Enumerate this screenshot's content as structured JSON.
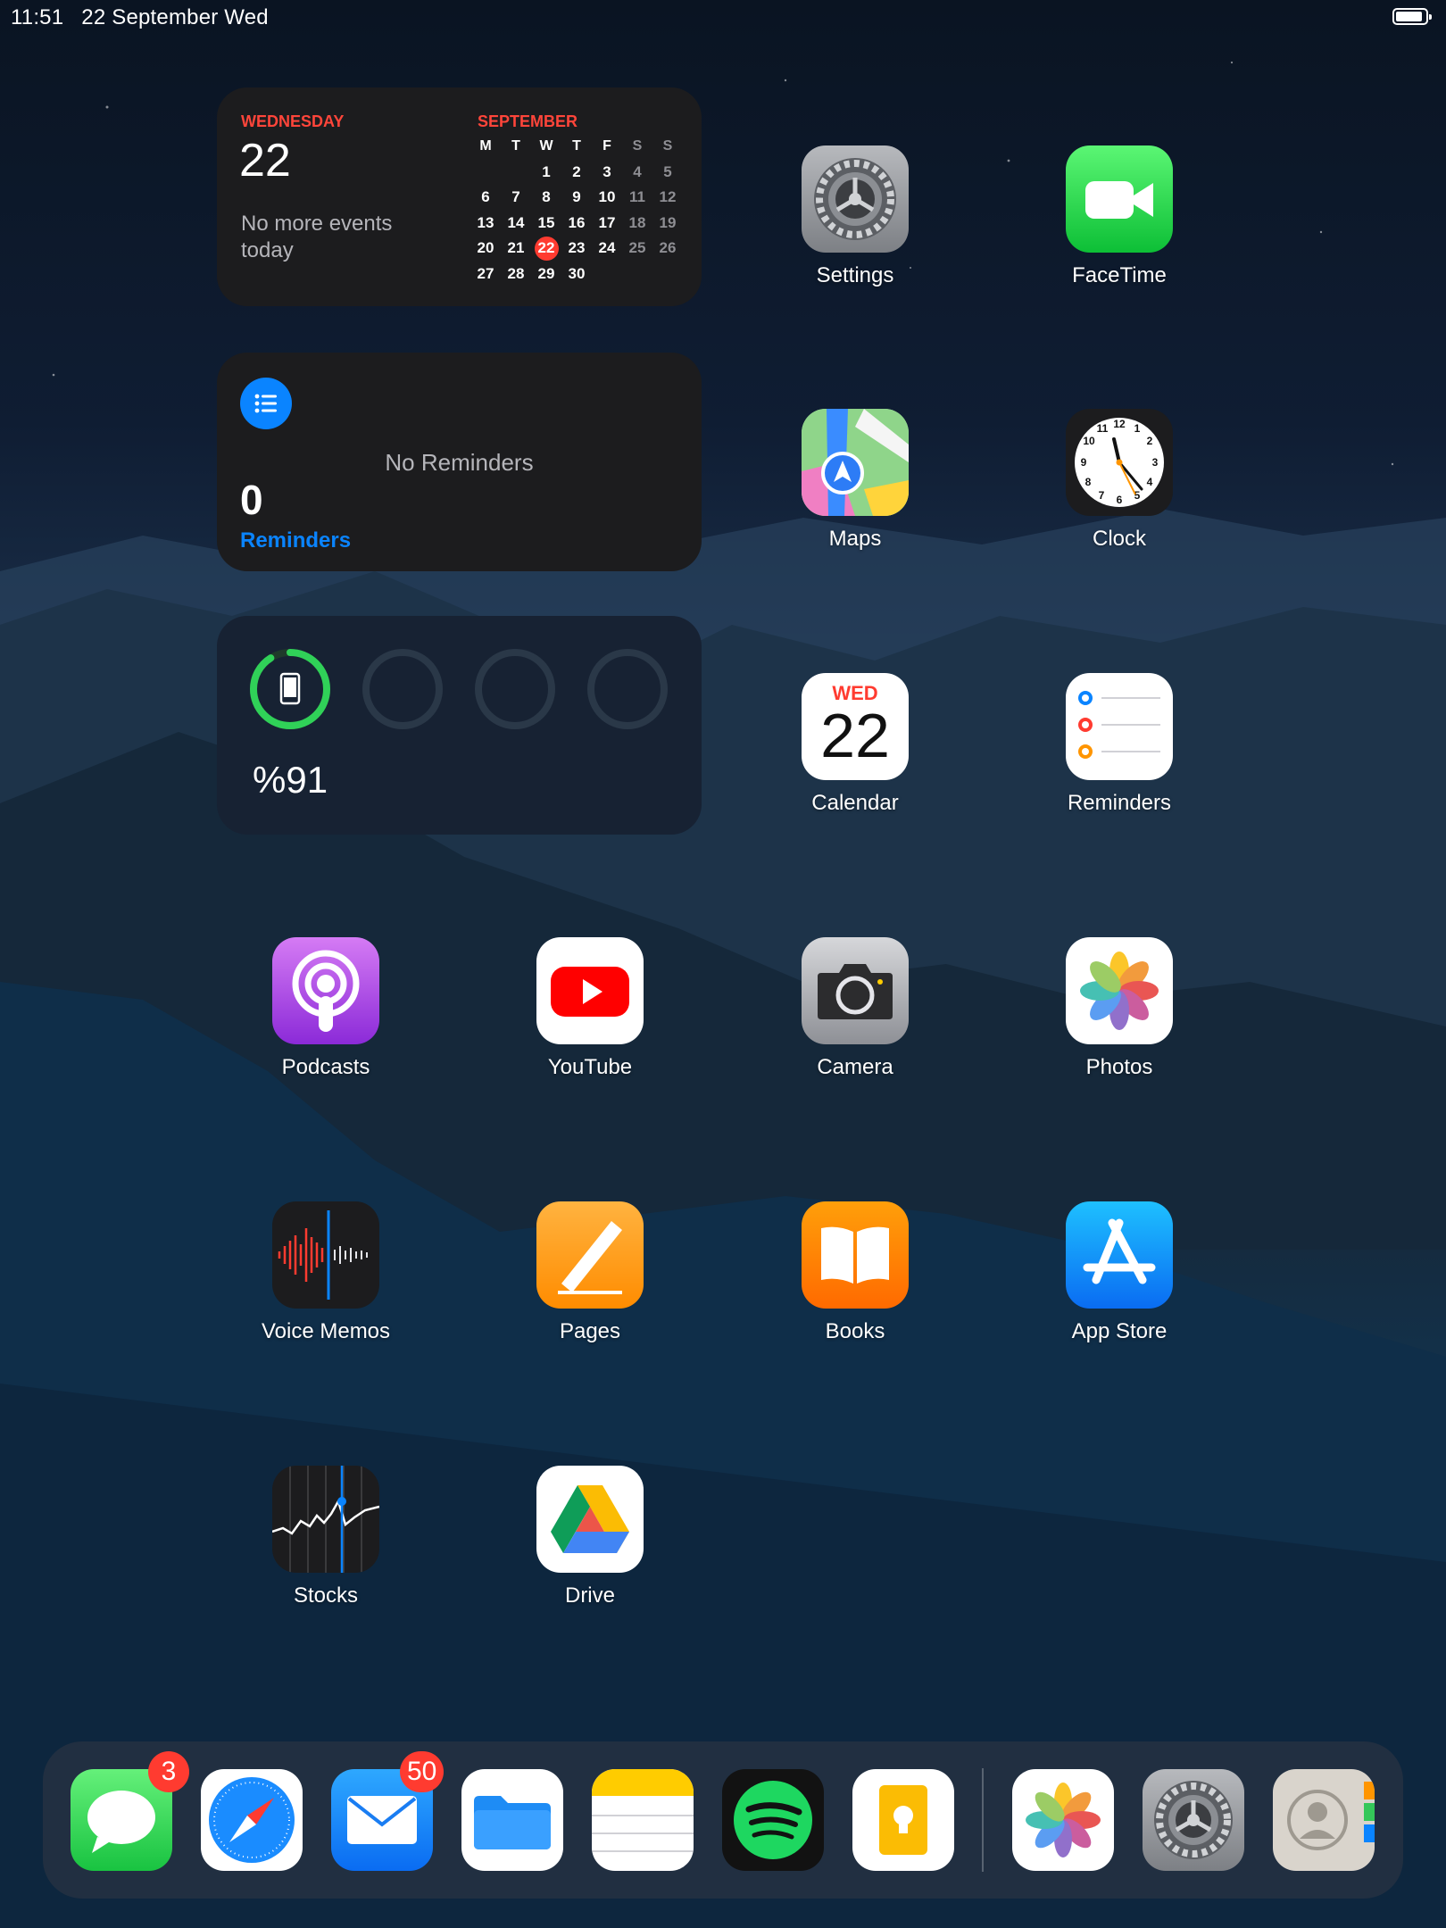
{
  "status_bar": {
    "time": "11:51",
    "date": "22 September Wed"
  },
  "calendar_widget": {
    "weekday": "WEDNESDAY",
    "day": "22",
    "no_events": "No more events today",
    "month": "SEPTEMBER",
    "headers": [
      "M",
      "T",
      "W",
      "T",
      "F",
      "S",
      "S"
    ],
    "weeks": [
      [
        "",
        "",
        "1",
        "2",
        "3",
        "4",
        "5"
      ],
      [
        "6",
        "7",
        "8",
        "9",
        "10",
        "11",
        "12"
      ],
      [
        "13",
        "14",
        "15",
        "16",
        "17",
        "18",
        "19"
      ],
      [
        "20",
        "21",
        "22",
        "23",
        "24",
        "25",
        "26"
      ],
      [
        "27",
        "28",
        "29",
        "30",
        "",
        "",
        ""
      ]
    ],
    "today": "22"
  },
  "reminders_widget": {
    "empty_text": "No Reminders",
    "count": "0",
    "label": "Reminders"
  },
  "batteries_widget": {
    "percent": "%91",
    "level": 0.91
  },
  "apps": [
    {
      "name": "settings",
      "label": "Settings"
    },
    {
      "name": "facetime",
      "label": "FaceTime"
    },
    {
      "name": "maps",
      "label": "Maps"
    },
    {
      "name": "clock",
      "label": "Clock"
    },
    {
      "name": "calendar",
      "label": "Calendar",
      "icon_day": "WED",
      "icon_date": "22"
    },
    {
      "name": "reminders",
      "label": "Reminders"
    },
    {
      "name": "podcasts",
      "label": "Podcasts"
    },
    {
      "name": "youtube",
      "label": "YouTube"
    },
    {
      "name": "camera",
      "label": "Camera"
    },
    {
      "name": "photos",
      "label": "Photos"
    },
    {
      "name": "voice-memos",
      "label": "Voice Memos"
    },
    {
      "name": "pages",
      "label": "Pages"
    },
    {
      "name": "books",
      "label": "Books"
    },
    {
      "name": "app-store",
      "label": "App Store"
    },
    {
      "name": "stocks",
      "label": "Stocks"
    },
    {
      "name": "drive",
      "label": "Drive"
    }
  ],
  "dock": {
    "messages_badge": "3",
    "mail_badge": "50",
    "items": [
      "messages",
      "safari",
      "mail",
      "files",
      "notes",
      "spotify",
      "keynote",
      "photos",
      "settings",
      "contacts"
    ]
  }
}
